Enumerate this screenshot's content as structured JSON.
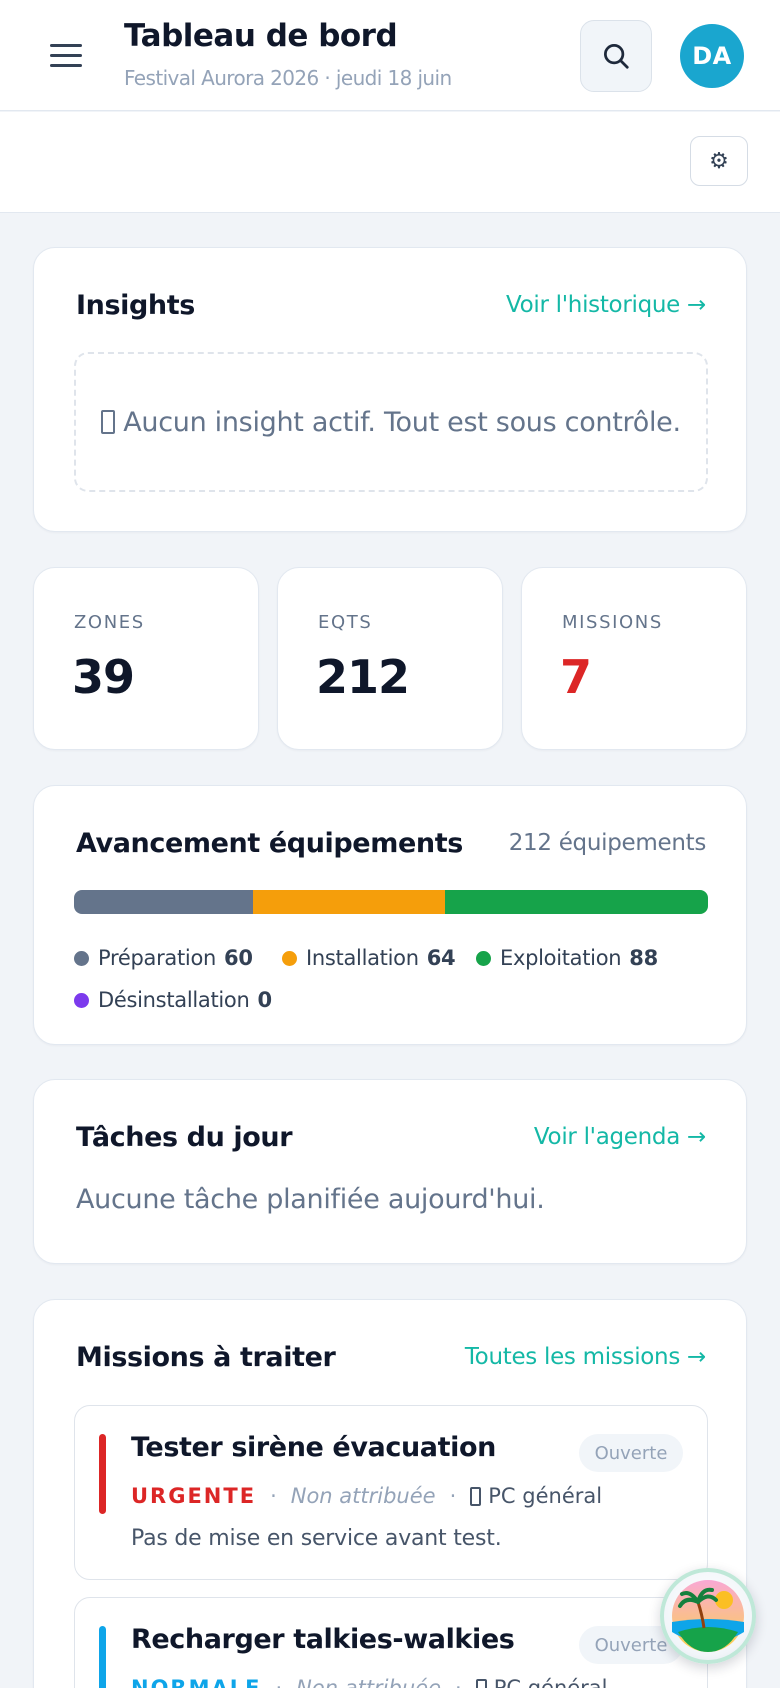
{
  "header": {
    "title": "Tableau de bord",
    "subtitle": "Festival Aurora 2026 · jeudi 18 juin",
    "avatar_initials": "DA",
    "menu_icon": "hamburger-menu-icon",
    "search_icon": "search-icon"
  },
  "toolbar": {
    "settings_icon": "gear-icon",
    "settings_glyph": "⚙"
  },
  "insights": {
    "title": "Insights",
    "link": "Voir l'historique →",
    "empty_text": "Aucun insight actif. Tout est sous contrôle."
  },
  "kpis": [
    {
      "label": "ZONES",
      "value": "39",
      "color": "#0f172a"
    },
    {
      "label": "EQTS",
      "value": "212",
      "color": "#0f172a"
    },
    {
      "label": "MISSIONS",
      "value": "7",
      "color": "#dc2626"
    }
  ],
  "equipment": {
    "title": "Avancement équipements",
    "count_label": "212 équipements",
    "stages": [
      {
        "label": "Préparation",
        "value": 60,
        "color": "#64748b"
      },
      {
        "label": "Installation",
        "value": 64,
        "color": "#f59e0b"
      },
      {
        "label": "Exploitation",
        "value": 88,
        "color": "#16a34a"
      },
      {
        "label": "Désinstallation",
        "value": 0,
        "color": "#7c3aed"
      }
    ]
  },
  "tasks": {
    "title": "Tâches du jour",
    "link": "Voir l'agenda →",
    "empty_text": "Aucune tâche planifiée aujourd'hui."
  },
  "missions": {
    "title": "Missions à traiter",
    "link": "Toutes les missions →",
    "items": [
      {
        "title": "Tester sirène évacuation",
        "status": "Ouverte",
        "priority": "URGENTE",
        "priority_color": "#dc2626",
        "assignee": "Non attribuée",
        "location": "PC général",
        "description": "Pas de mise en service avant test."
      },
      {
        "title": "Recharger talkies-walkies",
        "status": "Ouverte",
        "priority": "NORMALE",
        "priority_color": "#0ea5e9",
        "assignee": "Non attribuée",
        "location": "PC général",
        "description": ""
      }
    ]
  },
  "assistant": {
    "icon": "tropical-island-assistant-icon"
  }
}
